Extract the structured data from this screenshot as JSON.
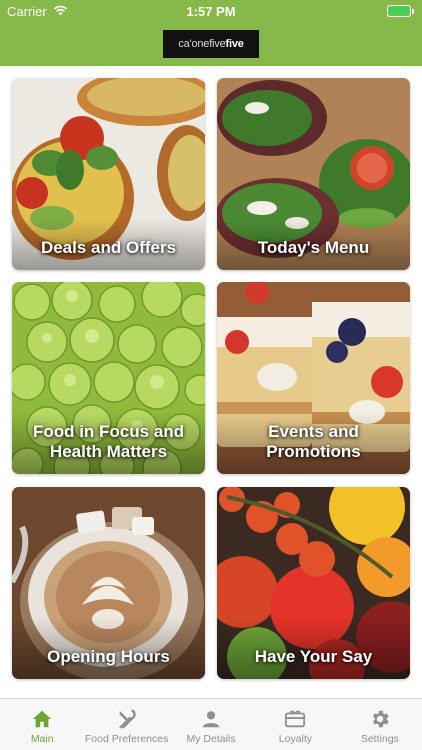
{
  "status_bar": {
    "carrier": "Carrier",
    "time": "1:57 PM",
    "battery_level": 1.0,
    "wifi_icon": "wifi-icon",
    "battery_icon": "battery-icon"
  },
  "header": {
    "logo": {
      "part1": "ca'",
      "part2": "one",
      "part3": "five",
      "part4": "five"
    },
    "background_color": "#86b94a"
  },
  "tiles": [
    {
      "label": "Deals and Offers"
    },
    {
      "label": "Today's Menu"
    },
    {
      "label": "Food in Focus and Health Matters"
    },
    {
      "label": "Events and Promotions"
    },
    {
      "label": "Opening Hours"
    },
    {
      "label": "Have Your Say"
    }
  ],
  "tabs": [
    {
      "label": "Main",
      "icon": "home-icon",
      "active": true
    },
    {
      "label": "Food Preferences",
      "icon": "fork-knife-icon",
      "active": false
    },
    {
      "label": "My Details",
      "icon": "person-icon",
      "active": false
    },
    {
      "label": "Loyalty",
      "icon": "gift-card-icon",
      "active": false
    },
    {
      "label": "Settings",
      "icon": "gear-icon",
      "active": false
    }
  ],
  "colors": {
    "accent": "#86b94a",
    "tab_active": "#6aa633",
    "tab_inactive": "#8e8e93"
  }
}
